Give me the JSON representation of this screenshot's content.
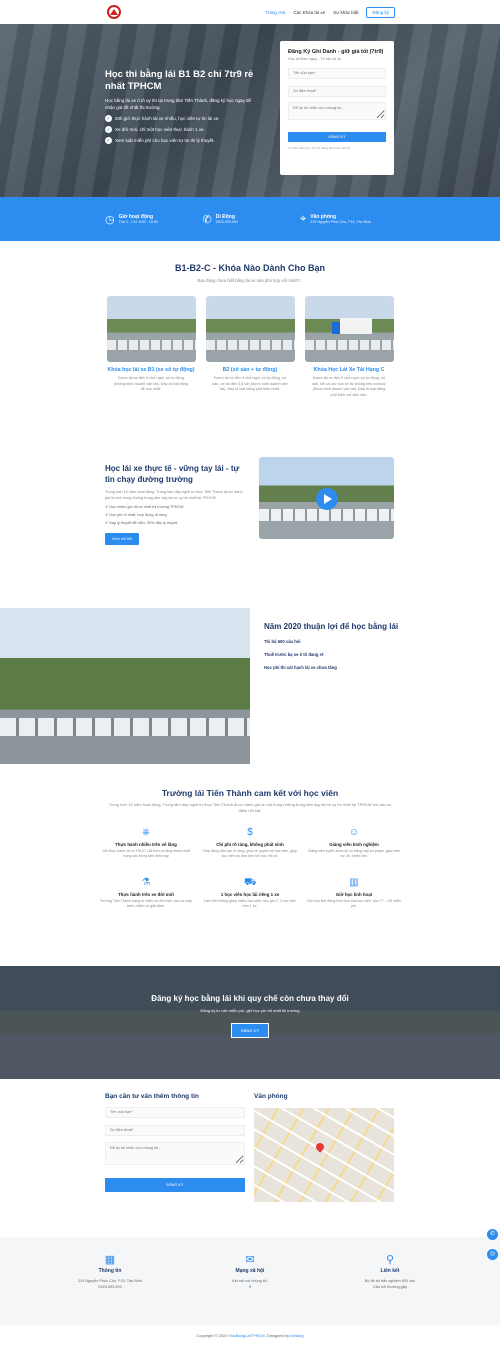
{
  "header": {
    "nav": [
      "Trang chủ",
      "Các Khóa tài xe",
      "Sự khác biệt",
      "Đăng ký"
    ]
  },
  "hero": {
    "title": "Học thi bằng lái B1 B2 chỉ 7tr9 rẻ nhất TPHCM",
    "desc": "Học bằng lái xe ô tô uy tín tại trung tâm Tiến Thành, đăng ký học ngay để nhận giá tốt nhất thị trường.",
    "bullets": [
      "20h giờ thực hành lái xe nhiều, học viên tự tin lái xe.",
      "Xe đời mới, chỉ một học viên thực hành 1 xe.",
      "Xem luật miễn phí cho học viên tự tin thi lý thuyết."
    ]
  },
  "form": {
    "title": "Đăng Ký Ghi Danh - giữ giá tốt (7tr9)",
    "sub": "Học lái Đầu ngay - Tư lấn lái xe",
    "name_ph": "Tên của bạn*",
    "phone_ph": "Số điện thoại*",
    "msg_ph": "Để lại lời nhắn cho chúng tôi...",
    "submit": "ĐĂNG KÝ",
    "note": "Tư vấn miễn phí - hỗ trợ đăng phải xem nhanh"
  },
  "bar": [
    {
      "title": "Giờ hoạt động",
      "text": "Thứ 2 - CN: 8:00 - 15:00"
    },
    {
      "title": "Di Động",
      "text": "0923.393.093"
    },
    {
      "title": "Văn phòng",
      "text": "219 Nguyễn Phúc Chu, F15, Tân Bình"
    }
  ],
  "courses": {
    "title": "B1-B2-C - Khóa Nào Dành Cho Bạn",
    "lead": "Bạn đang chưa biết bằng lái xe nào phù hợp với mình?..",
    "items": [
      {
        "name": "Khóa học lái xe B1 (xe số tự động)",
        "desc": "Được lái xe đến 9 chỗ ngồi, số tự động (không kinh doanh vận tải). Đây là loại bằng dễ học nhất."
      },
      {
        "name": "B2 (số sàn + tự động)",
        "desc": "Được lái xe đến 9 chỗ ngồi, số tự động, số sàn, xe tải đến 3,5 tấn (được kinh doanh vận tải). Đây là loại bằng phổ biến nhất."
      },
      {
        "name": "Khóa Học Lái Xe Tải Hạng C",
        "desc": "Được lái xe đến 9 chỗ ngồi, số tự động, số sàn, tất cả các loại xe tải không kéo romooc (được kinh doanh vận tải). Đây là loại bằng phổ biến với việc làm."
      }
    ]
  },
  "practice": {
    "title": "Học lái xe thực tế - vững tay lái - tự tin chạy đường trường",
    "desc": "Trong hơn 10 năm hoạt động, Trung tâm dạy nghề tư thục Tiến Thành được đánh giá là một trong những trung tâm dạy lái xe uy tín nhất tại TPHCM.",
    "bullets": [
      "Học nhiều giờ lái xe nhất thị trường TPHCM",
      "Học phí rõ nhất, hợp đồng rõ ràng",
      "Dạy lý thuyết để hiểu, 99% đậu lý thuyết."
    ],
    "button": "Xem chi tiết"
  },
  "year": {
    "title": "Năm 2020 thuận lợi để học bằng lái",
    "items": [
      "Thi bộ 600 câu hỏi",
      "Thuế trước bạ xe ô tô đang rẻ",
      "Học phí thi sát hạch lái xe chưa tăng"
    ]
  },
  "commit": {
    "title": "Trường lái Tiến Thành cam kết với học viên",
    "lead": "Trong hơn 10 năm hoạt động, Trung tâm dạy nghề tư thục Tiến Thành được đánh giá là một trong những trung tâm dạy lái xe uy tín nhất tại TPHCM với các ưu điểm nổi bật.",
    "items": [
      {
        "title": "Thực hành nhiều trên vô lăng",
        "text": "Giờ thực hành lái xe THỰC LÁI trên vô lăng nhiều nhất trong các trung tâm hiện nay"
      },
      {
        "title": "Chi phí rõ ràng, không phát sinh",
        "text": "Hợp đồng đào tạo rõ ràng, giúp về quyền lợi học viên, giúp học viên an tâm hơn khi học, thi cử."
      },
      {
        "title": "Giảng viên kinh nghiệm",
        "text": "Giảng viên tuyển chọn kỹ có bằng cấp sư phạm, giáo viên vui vẻ, nhiệt tình."
      },
      {
        "title": "Thực hành trên xe đời mới",
        "text": "Trường Tiến Thành trang bị nhiều xe đời mới, học có máy lạnh, nhiều xe giải đớm."
      },
      {
        "title": "1 học viên học lái riêng 1 xe",
        "text": "Cam kết không ghép nhiều học viên, học giờ 2, 3 học viên trên 1 xe."
      },
      {
        "title": "Giờ học linh hoạt",
        "text": "Giờ học linh động theo lịch của học viên, học T7 - CN miễn phí."
      }
    ]
  },
  "cta": {
    "title": "Đăng ký học bằng lái khi quy chế còn chưa thay đổi",
    "sub": "Đăng ký tư vấn miễn phí, giữ học phí tốt nhất thị trường",
    "button": "ĐĂNG KÝ"
  },
  "contact": {
    "title": "Bạn cần tư vấn thêm thông tin",
    "name_ph": "Tên của bạn*",
    "phone_ph": "Số điện thoại*",
    "msg_ph": "Để lại lời nhắn cho chúng tôi...",
    "submit": "ĐĂNG KÝ",
    "office": "Văn phòng"
  },
  "footer": [
    {
      "title": "Thông tin",
      "text": "219 Nguyễn Phúc Chu, F15, Tân Bình",
      "text2": "0923.393.093"
    },
    {
      "title": "Mạng xã hội",
      "text": "Kết nối với chúng tôi.",
      "text2": "f"
    },
    {
      "title": "Liên kết",
      "text": "Bộ đề thi trắc nghiệm 600 câu",
      "text2": "Câu hỏi thường gặp"
    }
  ],
  "copyright": {
    "prefix": "Copyright © 2020 ",
    "site": "HocBangLaiTPHCM",
    "mid": ". Designed by ",
    "designer": "kvBang"
  }
}
